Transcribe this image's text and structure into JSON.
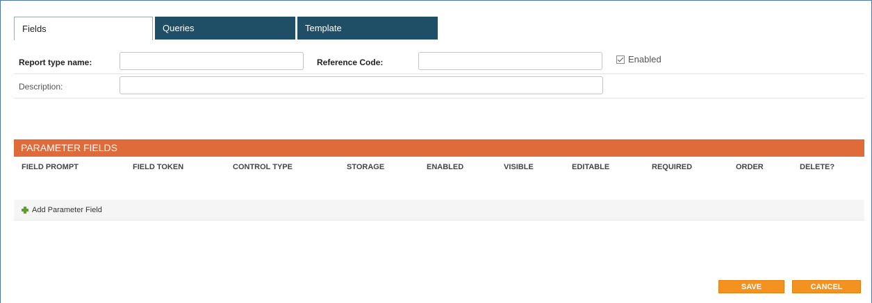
{
  "tabs": [
    {
      "label": "Fields",
      "active": true
    },
    {
      "label": "Queries",
      "active": false
    },
    {
      "label": "Template",
      "active": false
    }
  ],
  "form": {
    "report_type_name_label": "Report type name:",
    "report_type_name_value": "",
    "reference_code_label": "Reference Code:",
    "reference_code_value": "",
    "enabled_label": "Enabled",
    "enabled_checked": true,
    "description_label": "Description:",
    "description_value": ""
  },
  "parameter_fields": {
    "title": "PARAMETER FIELDS",
    "columns": [
      "FIELD PROMPT",
      "FIELD TOKEN",
      "CONTROL TYPE",
      "STORAGE",
      "ENABLED",
      "VISIBLE",
      "EDITABLE",
      "REQUIRED",
      "ORDER",
      "DELETE?"
    ],
    "add_label": "Add Parameter Field"
  },
  "actions": {
    "save_label": "SAVE",
    "cancel_label": "CANCEL"
  },
  "colors": {
    "tab_dark": "#1f4e67",
    "section_header": "#df6a3a",
    "button": "#f39221",
    "add_icon": "#5aa02c"
  }
}
